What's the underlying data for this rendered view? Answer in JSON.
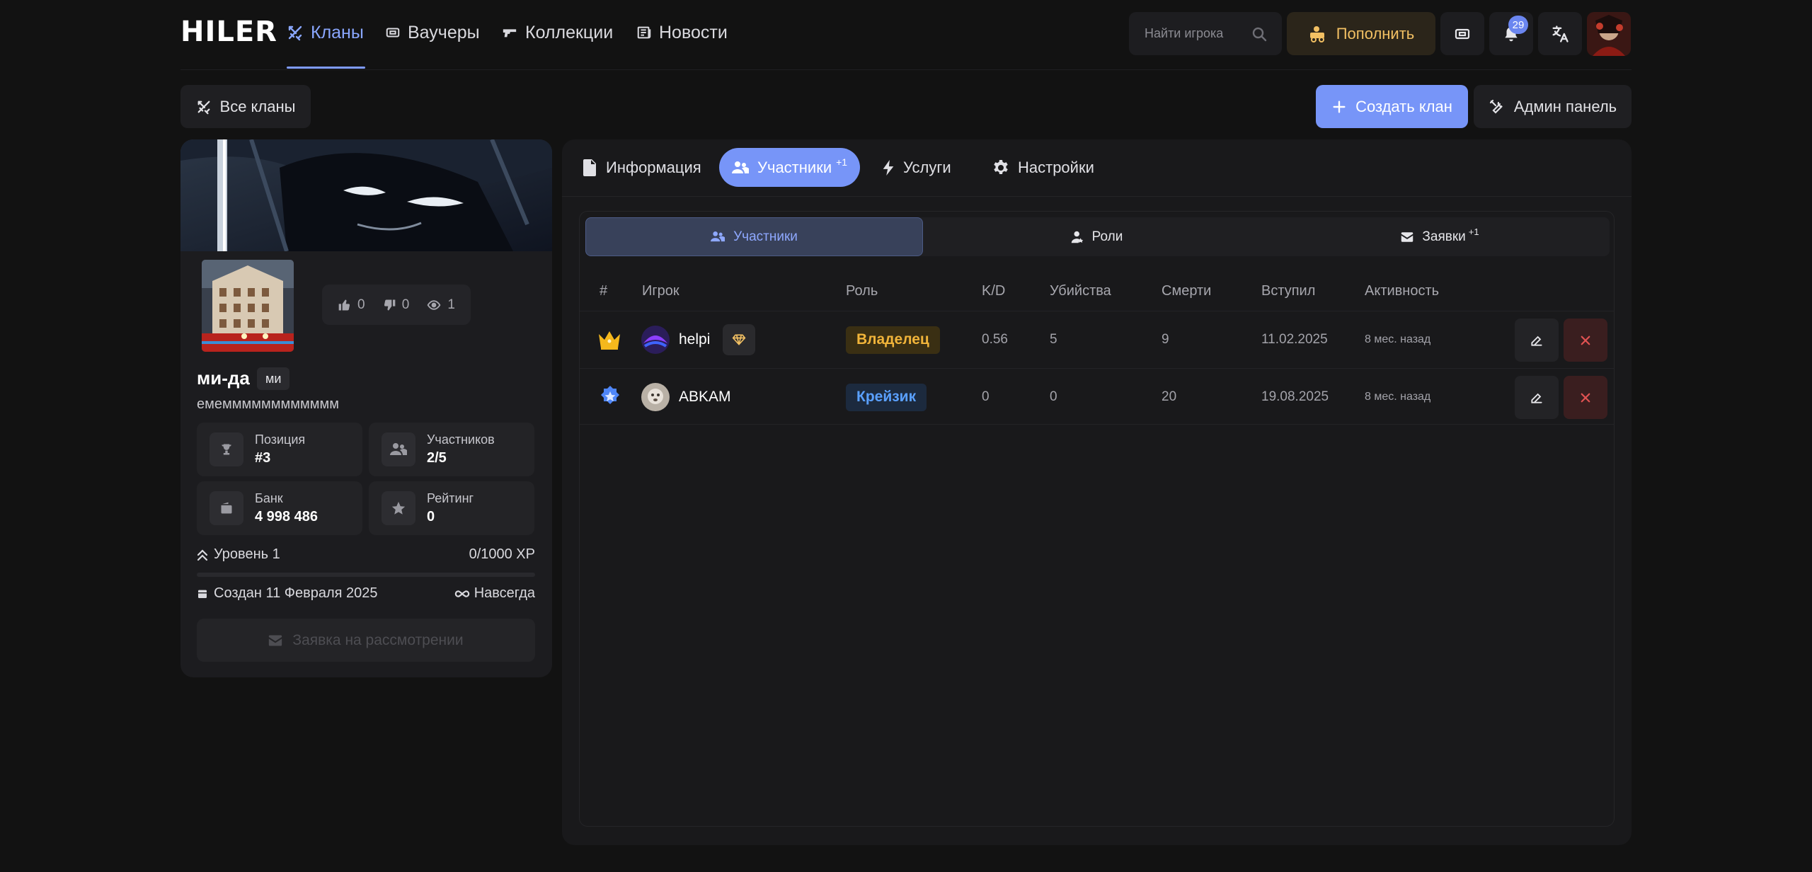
{
  "brand": "HILER",
  "nav": {
    "items": [
      {
        "label": "Кланы",
        "icon": "swords-icon"
      },
      {
        "label": "Ваучеры",
        "icon": "ticket-icon"
      },
      {
        "label": "Коллекции",
        "icon": "gun-icon"
      },
      {
        "label": "Новости",
        "icon": "newspaper-icon"
      }
    ],
    "search_placeholder": "Найти игрока",
    "topup_label": "Пополнить",
    "notifications_count": "29"
  },
  "subheader": {
    "all_clans": "Все кланы",
    "create_clan": "Создать клан",
    "admin_panel": "Админ панель"
  },
  "clan": {
    "name": "ми-да",
    "tag": "ми",
    "description": "емемммммммммммм",
    "likes": "0",
    "dislikes": "0",
    "views": "1",
    "stats": {
      "position_label": "Позиция",
      "position_value": "#3",
      "members_label": "Участников",
      "members_value": "2/5",
      "bank_label": "Банк",
      "bank_value": "4 998 486",
      "rating_label": "Рейтинг",
      "rating_value": "0"
    },
    "level_label": "Уровень 1",
    "xp_label": "0/1000 XP",
    "xp_progress": 0,
    "created_label": "Создан 11 Февраля 2025",
    "duration_label": "Навсегда",
    "apply_label": "Заявка на рассмотрении"
  },
  "tabs": {
    "info": "Информация",
    "members": "Участники",
    "members_sup": "+1",
    "services": "Услуги",
    "settings": "Настройки"
  },
  "subtabs": {
    "members": "Участники",
    "roles": "Роли",
    "requests": "Заявки",
    "requests_sup": "+1"
  },
  "table": {
    "headers": [
      "#",
      "Игрок",
      "Роль",
      "K/D",
      "Убийства",
      "Смерти",
      "Вступил",
      "Активность"
    ],
    "rows": [
      {
        "rank_icon": "crown-icon",
        "player": "helpi",
        "role": "Владелец",
        "role_color": "#f1b43a",
        "kd": "0.56",
        "kills": "5",
        "deaths": "9",
        "joined": "11.02.2025",
        "activity": "8 мес. назад"
      },
      {
        "rank_icon": "star-badge-icon",
        "player": "ABKAM",
        "role": "Крейзик",
        "role_color": "#5aa0ff",
        "kd": "0",
        "kills": "0",
        "deaths": "20",
        "joined": "19.08.2025",
        "activity": "8 мес. назад"
      }
    ]
  },
  "colors": {
    "accent": "#7795f8",
    "gold": "#f2c063",
    "danger": "#e05252"
  }
}
